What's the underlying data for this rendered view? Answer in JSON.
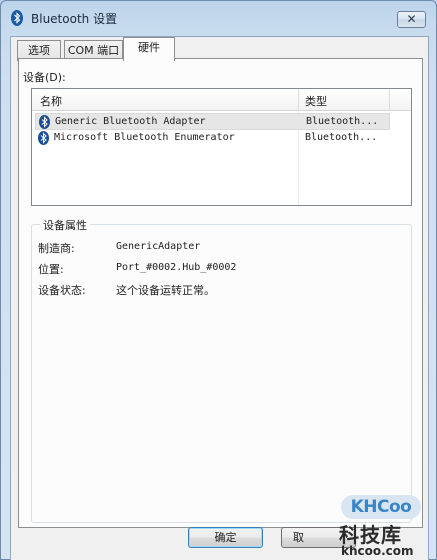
{
  "window": {
    "title": "Bluetooth 设置",
    "close_glyph": "✕"
  },
  "tabs": [
    {
      "label": "选项",
      "active": false
    },
    {
      "label": "COM 端口",
      "active": false
    },
    {
      "label": "硬件",
      "active": true
    }
  ],
  "devices": {
    "label": "设备(D):",
    "columns": {
      "name": "名称",
      "type": "类型"
    },
    "rows": [
      {
        "name": "Generic Bluetooth Adapter",
        "type": "Bluetooth...",
        "selected": true,
        "icon": "bluetooth-icon"
      },
      {
        "name": "Microsoft Bluetooth Enumerator",
        "type": "Bluetooth...",
        "selected": false,
        "icon": "bluetooth-icon"
      }
    ]
  },
  "properties": {
    "title": "设备属性",
    "manufacturer_label": "制造商:",
    "manufacturer_value": "GenericAdapter",
    "location_label": "位置:",
    "location_value": "Port_#0002.Hub_#0002",
    "status_label": "设备状态:",
    "status_value": "这个设备运转正常。"
  },
  "buttons": {
    "ok": "确定",
    "partial": "取"
  },
  "watermark": {
    "logo": "KHCoo",
    "cn": "科技库",
    "url": "khcoo.com"
  },
  "colors": {
    "frame": "#c7dbee",
    "panel": "#fcfcfc",
    "selection": "#e6e6e6"
  }
}
